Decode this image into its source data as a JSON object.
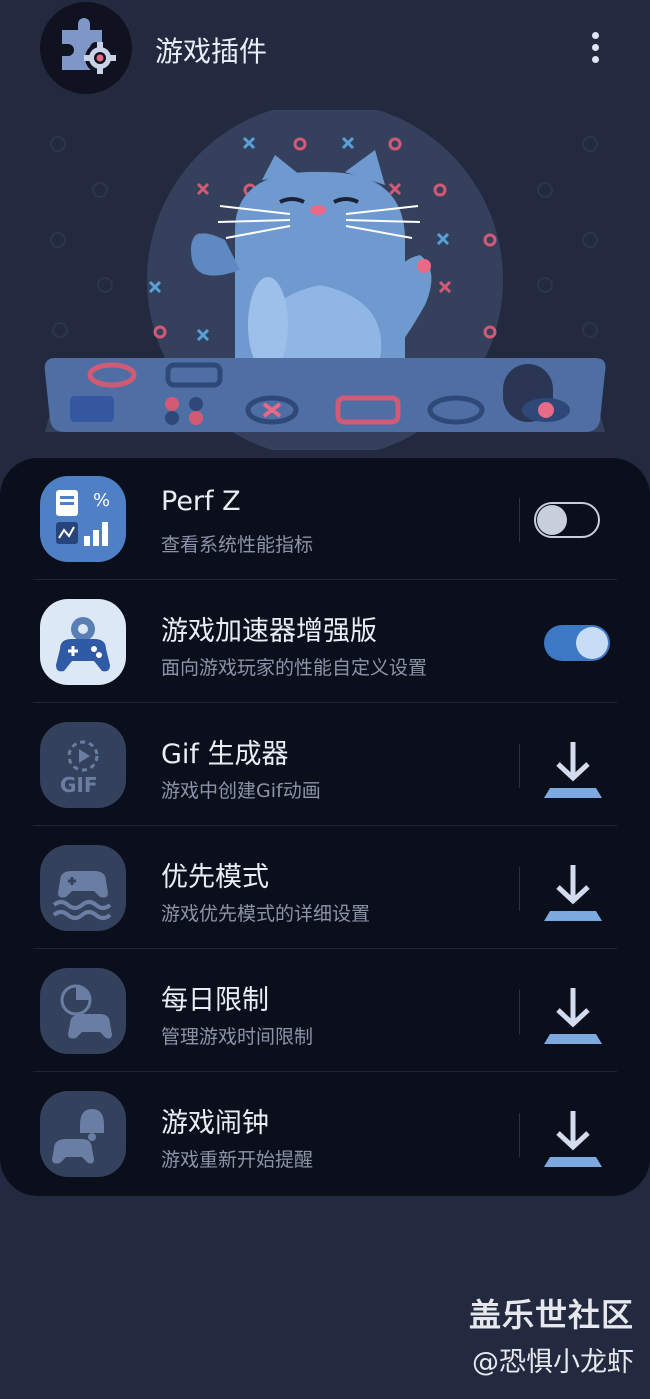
{
  "header": {
    "title": "游戏插件",
    "app_icon": "puzzle-gear-icon",
    "menu_icon": "more-vertical-icon"
  },
  "hero": {
    "illustration": "cat-keyboard-illustration"
  },
  "plugins": [
    {
      "name": "Perf Z",
      "description": "查看系统性能指标",
      "icon": "perf-z-icon",
      "control": "toggle",
      "enabled": false
    },
    {
      "name": "游戏加速器增强版",
      "description": "面向游戏玩家的性能自定义设置",
      "icon": "game-booster-plus-icon",
      "control": "toggle",
      "enabled": true
    },
    {
      "name": "Gif 生成器",
      "description": "游戏中创建Gif动画",
      "icon": "gif-maker-icon",
      "control": "download"
    },
    {
      "name": "优先模式",
      "description": "游戏优先模式的详细设置",
      "icon": "priority-mode-icon",
      "control": "download"
    },
    {
      "name": "每日限制",
      "description": "管理游戏时间限制",
      "icon": "daily-limit-icon",
      "control": "download"
    },
    {
      "name": "游戏闹钟",
      "description": "游戏重新开始提醒",
      "icon": "game-alarm-icon",
      "control": "download"
    }
  ],
  "watermark": {
    "line1": "盖乐世社区",
    "line2": "@恐惧小龙虾"
  },
  "colors": {
    "background": "#232a3f",
    "panel": "#0b0f1c",
    "accent": "#3c78c4",
    "download": "#7ba9e0"
  }
}
